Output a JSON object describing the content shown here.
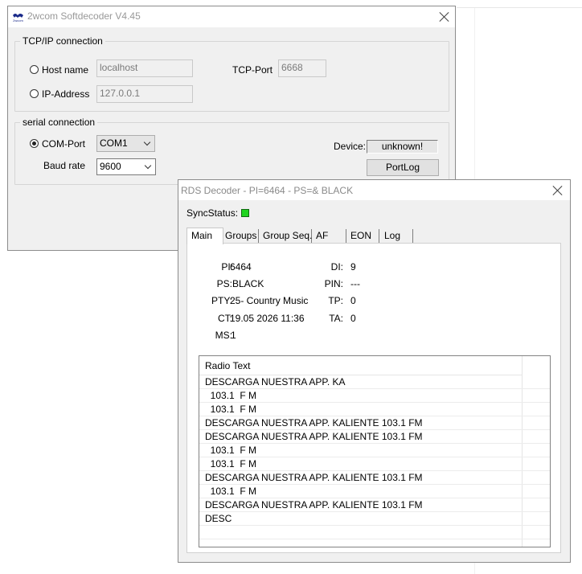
{
  "softdecoder": {
    "title": "2wcom Softdecoder V4.45",
    "logo_text": "2wcom",
    "tcpip": {
      "group_title": "TCP/IP connection",
      "hostname_label": "Host name",
      "hostname_value": "localhost",
      "ip_label": "IP-Address",
      "ip_value": "127.0.0.1",
      "tcpport_label": "TCP-Port",
      "tcpport_value": "6668"
    },
    "serial": {
      "group_title": "serial connection",
      "comport_label": "COM-Port",
      "comport_value": "COM1",
      "baud_label": "Baud rate",
      "baud_value": "9600",
      "device_label": "Device:",
      "device_value": "unknown!",
      "portlog_label": "PortLog"
    }
  },
  "rds": {
    "title": "RDS Decoder - PI=6464 - PS=& BLACK",
    "sync_label": "SyncStatus:",
    "status_color": "#1fd41f",
    "tabs": [
      "Main",
      "Groups",
      "Group Seq.",
      "AF",
      "EON",
      "Log"
    ],
    "fields": {
      "pi_label": "PI:",
      "pi_value": "6464",
      "ps_label": "PS:",
      "ps_value": "BLACK",
      "pty_label": "PTY:",
      "pty_value": "25- Country Music",
      "ct_label": "CT:",
      "ct_value": "19.05 2026 11:36",
      "ms_label": "MS:",
      "ms_value": "1",
      "di_label": "DI:",
      "di_value": "9",
      "pin_label": "PIN:",
      "pin_value": "---",
      "tp_label": "TP:",
      "tp_value": "0",
      "ta_label": "TA:",
      "ta_value": "0"
    },
    "radiotext_header": "Radio Text",
    "radiotext_rows": [
      "DESCARGA NUESTRA APP. KA",
      "  103.1  F M",
      "  103.1  F M",
      "DESCARGA NUESTRA APP. KALIENTE 103.1 FM",
      "DESCARGA NUESTRA APP. KALIENTE 103.1 FM",
      "  103.1  F M",
      "  103.1  F M",
      "DESCARGA NUESTRA APP. KALIENTE 103.1 FM",
      "  103.1  F M",
      "DESCARGA NUESTRA APP. KALIENTE 103.1 FM",
      "DESC",
      ""
    ]
  }
}
